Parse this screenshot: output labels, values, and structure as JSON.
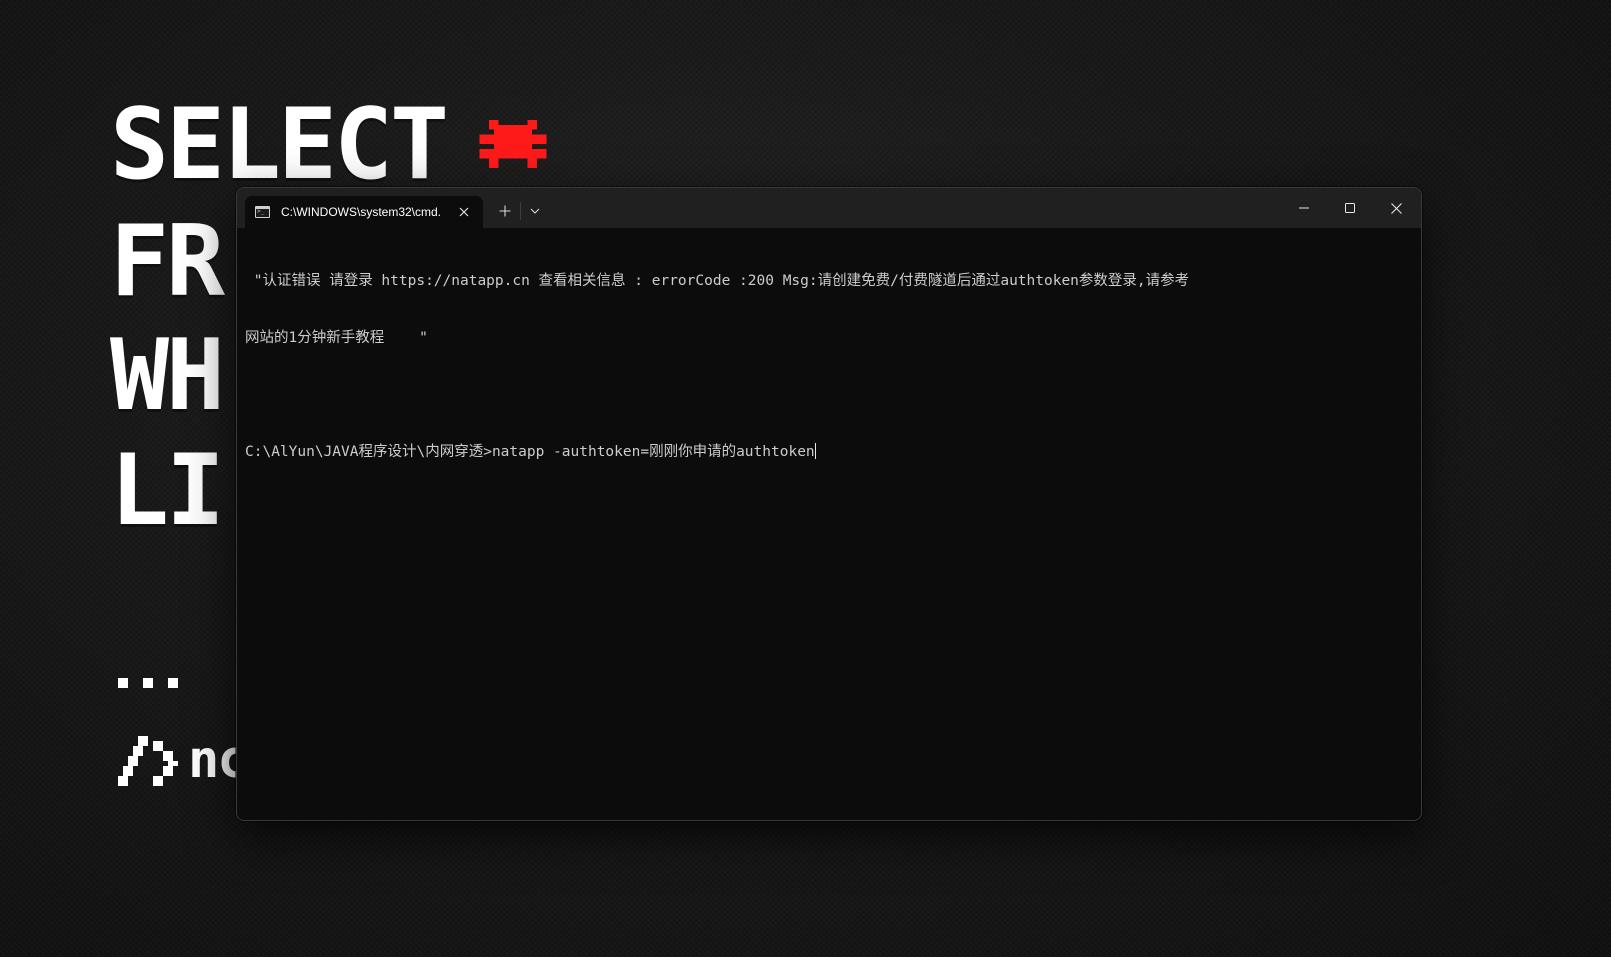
{
  "wallpaper": {
    "words": [
      "SELECT",
      "FR",
      "WH",
      "LI"
    ],
    "brand_fragment": "nc",
    "accent_color": "#ff1a1a"
  },
  "terminal": {
    "tab_title": "C:\\WINDOWS\\system32\\cmd.",
    "tab_icon": "terminal-icon",
    "new_tab_icon": "plus-icon",
    "dropdown_icon": "chevron-down-icon",
    "window_controls": [
      "minimize-icon",
      "maximize-icon",
      "close-icon"
    ],
    "background_color": "#0c0c0c",
    "text_color": "#cccccc",
    "lines": [
      " \"认证错误 请登录 https://natapp.cn 查看相关信息 : errorCode :200 Msg:请创建免费/付费隧道后通过authtoken参数登录,请参考",
      "网站的1分钟新手教程    \"",
      "",
      "C:\\AlYun\\JAVA程序设计\\内网穿透>natapp -authtoken=刚刚你申请的authtoken"
    ]
  }
}
